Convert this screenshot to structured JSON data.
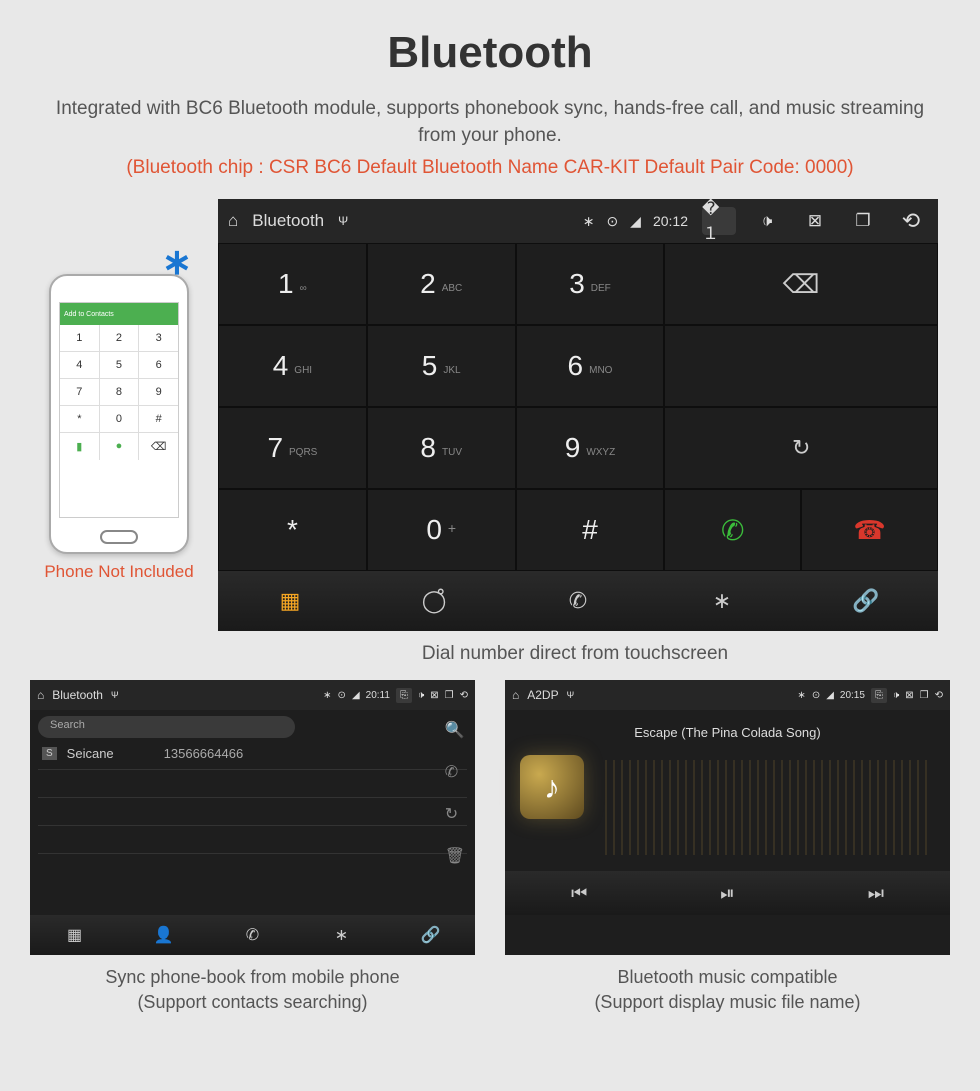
{
  "title": "Bluetooth",
  "subtitle": "Integrated with BC6 Bluetooth module, supports phonebook sync, hands-free call, and music streaming from your phone.",
  "spec": "(Bluetooth chip : CSR BC6    Default Bluetooth Name CAR-KIT    Default Pair Code: 0000)",
  "phone": {
    "header": "Add to Contacts",
    "caption": "Phone Not Included"
  },
  "main_screen": {
    "status": {
      "title": "Bluetooth",
      "time": "20:12"
    },
    "keys": [
      {
        "n": "1",
        "s": "∞"
      },
      {
        "n": "2",
        "s": "ABC"
      },
      {
        "n": "3",
        "s": "DEF"
      },
      {
        "n": "4",
        "s": "GHI"
      },
      {
        "n": "5",
        "s": "JKL"
      },
      {
        "n": "6",
        "s": "MNO"
      },
      {
        "n": "7",
        "s": "PQRS"
      },
      {
        "n": "8",
        "s": "TUV"
      },
      {
        "n": "9",
        "s": "WXYZ"
      },
      {
        "n": "*",
        "s": ""
      },
      {
        "n": "0",
        "s": "+"
      },
      {
        "n": "#",
        "s": ""
      }
    ],
    "caption": "Dial number direct from touchscreen"
  },
  "contacts_screen": {
    "status": {
      "title": "Bluetooth",
      "time": "20:11"
    },
    "search_placeholder": "Search",
    "contact": {
      "tag": "S",
      "name": "Seicane",
      "number": "13566664466"
    },
    "caption_l1": "Sync phone-book from mobile phone",
    "caption_l2": "(Support contacts searching)"
  },
  "music_screen": {
    "status": {
      "title": "A2DP",
      "time": "20:15"
    },
    "track": "Escape (The Pina Colada Song)",
    "caption_l1": "Bluetooth music compatible",
    "caption_l2": "(Support display music file name)"
  }
}
